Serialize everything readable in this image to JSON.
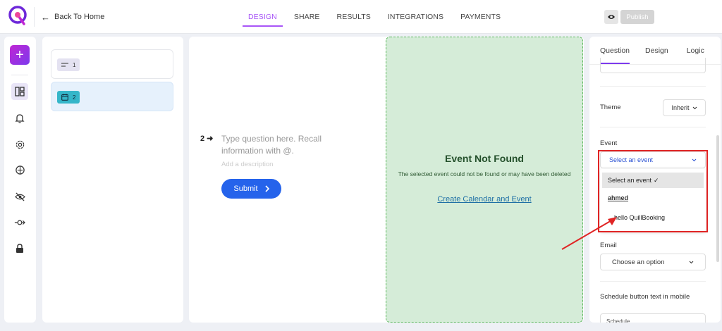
{
  "topbar": {
    "back_label": "Back To Home",
    "tabs": [
      {
        "label": "DESIGN",
        "active": true
      },
      {
        "label": "SHARE",
        "active": false
      },
      {
        "label": "RESULTS",
        "active": false
      },
      {
        "label": "INTEGRATIONS",
        "active": false
      },
      {
        "label": "PAYMENTS",
        "active": false
      }
    ],
    "publish_label": "Publish"
  },
  "colors": {
    "accent": "#a855f7",
    "primary": "#2563eb",
    "event_panel_bg": "#d5ecd8",
    "annotation": "#e02424"
  },
  "rail": {
    "icons": [
      "plus-icon",
      "layout-icon",
      "bell-icon",
      "gear-icon",
      "logic-icon",
      "eye-off-icon",
      "commit-icon",
      "lock-icon"
    ]
  },
  "blocks": [
    {
      "number": "1",
      "icon": "short-text-icon",
      "selected": false
    },
    {
      "number": "2",
      "icon": "calendar-icon",
      "selected": true
    }
  ],
  "question": {
    "number": "2",
    "placeholder": "Type question here. Recall information with @.",
    "description_placeholder": "Add a description",
    "submit_label": "Submit"
  },
  "event_panel": {
    "title": "Event Not Found",
    "message": "The selected event could not be found or may have been deleted",
    "link": "Create Calendar and Event"
  },
  "right_panel": {
    "tabs": [
      {
        "label": "Question",
        "active": true
      },
      {
        "label": "Design",
        "active": false
      },
      {
        "label": "Logic",
        "active": false
      }
    ],
    "theme_label": "Theme",
    "theme_value": "Inherit",
    "event_label": "Event",
    "event_value": "Select an event",
    "event_options": {
      "selected": "Select an event",
      "group": "ahmed",
      "items": [
        "hello QuillBooking"
      ]
    },
    "email_label": "Email",
    "email_value": "Choose an option",
    "schedule_label": "Schedule button text in mobile",
    "schedule_value": "Schedule"
  }
}
